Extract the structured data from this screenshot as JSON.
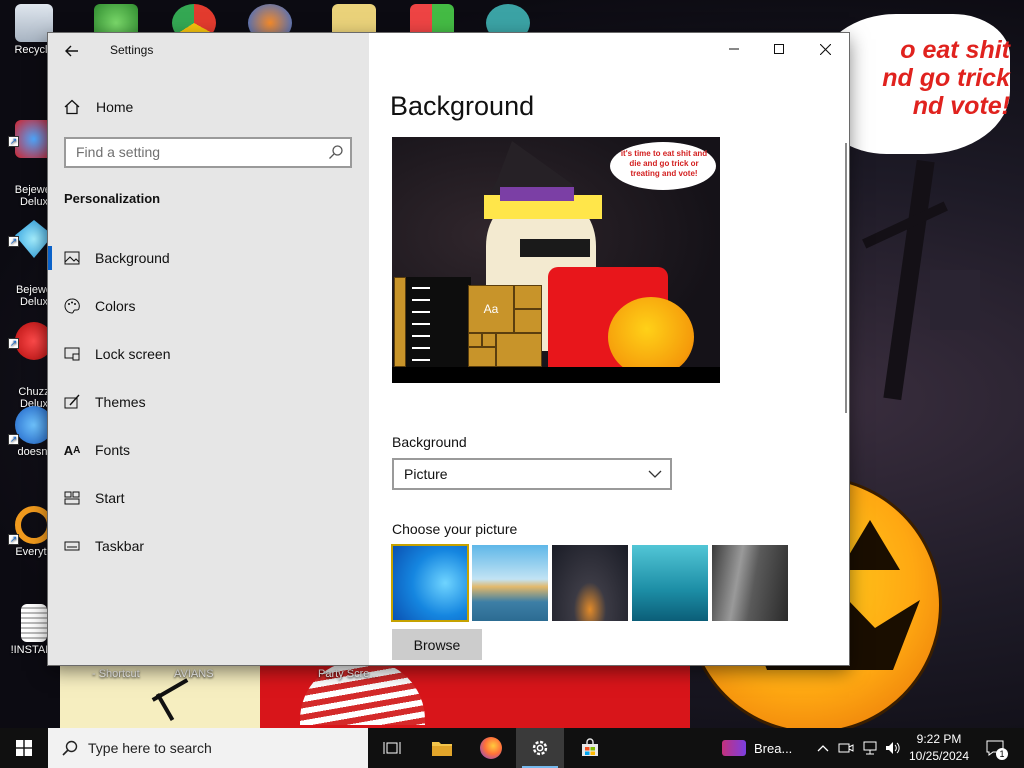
{
  "desktop": {
    "wallpaper_text": "o eat shit\nnd go trick\nnd vote!",
    "icons": [
      {
        "label": "Recycle",
        "name": "recycle-bin-icon"
      },
      {
        "label": "Bejewel\nDelux",
        "name": "bejeweled-icon"
      },
      {
        "label": "Bejewe\nDelux",
        "name": "bejeweled-3-icon"
      },
      {
        "label": "Chuzz\nDelux",
        "name": "chuzzle-icon"
      },
      {
        "label": "doesnt",
        "name": "doesnt-icon"
      },
      {
        "label": "Everyth",
        "name": "everything-icon"
      },
      {
        "label": "!INSTALL",
        "name": "install-file-icon"
      }
    ],
    "bottom_labels": [
      "- Shortcut",
      "AVIANS",
      "Party Scre..."
    ]
  },
  "settings": {
    "window_title": "Settings",
    "home_label": "Home",
    "search_placeholder": "Find a setting",
    "section_heading": "Personalization",
    "nav_items": [
      {
        "label": "Background",
        "icon": "picture-icon",
        "active": true
      },
      {
        "label": "Colors",
        "icon": "palette-icon",
        "active": false
      },
      {
        "label": "Lock screen",
        "icon": "lock-screen-icon",
        "active": false
      },
      {
        "label": "Themes",
        "icon": "themes-icon",
        "active": false
      },
      {
        "label": "Fonts",
        "icon": "fonts-icon",
        "active": false
      },
      {
        "label": "Start",
        "icon": "start-icon",
        "active": false
      },
      {
        "label": "Taskbar",
        "icon": "taskbar-icon",
        "active": false
      }
    ],
    "page_title": "Background",
    "preview": {
      "bubble_text": "it's time to eat shit and die and go trick or treating and vote!",
      "tile_text": "Aa"
    },
    "background_label": "Background",
    "background_value": "Picture",
    "choose_label": "Choose your picture",
    "thumbnails": [
      {
        "name": "windows-blue",
        "selected": true
      },
      {
        "name": "beach-rocks",
        "selected": false
      },
      {
        "name": "night-sky",
        "selected": false
      },
      {
        "name": "underwater-swimmer",
        "selected": false
      },
      {
        "name": "rock-cliff",
        "selected": false
      }
    ],
    "browse_label": "Browse"
  },
  "taskbar": {
    "search_placeholder": "Type here to search",
    "running_app_label": "Brea...",
    "time": "9:22 PM",
    "date": "10/25/2024",
    "notification_count": "1"
  },
  "colors": {
    "accent": "#0a62c9",
    "nav_bg": "#e6e6e6",
    "taskbar_bg": "#101010"
  }
}
